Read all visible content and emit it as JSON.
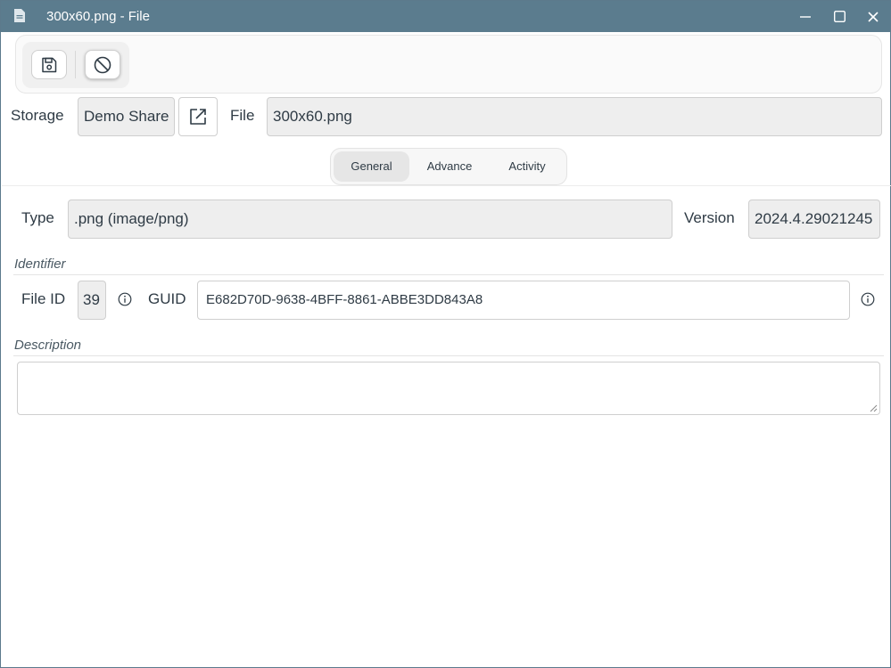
{
  "window": {
    "title": "300x60.png - File",
    "icons": {
      "app": "document-icon",
      "minimize": "minimize-icon",
      "maximize": "maximize-icon",
      "close": "close-icon"
    }
  },
  "toolbar": {
    "buttons": [
      {
        "name": "save",
        "icon": "save-icon"
      },
      {
        "name": "cancel",
        "icon": "cancel-icon"
      }
    ]
  },
  "header": {
    "storage_label": "Storage",
    "storage_value": "Demo Share",
    "open_icon": "external-link-icon",
    "file_label": "File",
    "file_value": "300x60.png"
  },
  "tabs": [
    {
      "label": "General",
      "active": true
    },
    {
      "label": "Advance",
      "active": false
    },
    {
      "label": "Activity",
      "active": false
    }
  ],
  "general": {
    "type_label": "Type",
    "type_value": ".png (image/png)",
    "version_label": "Version",
    "version_value": "2024.4.29021245",
    "identifier_section": "Identifier",
    "file_id_label": "File ID",
    "file_id_value": "39",
    "guid_label": "GUID",
    "guid_value": "E682D70D-9638-4BFF-8861-ABBE3DD843A8",
    "description_section": "Description",
    "description_value": ""
  },
  "colors": {
    "titlebar": "#5b7c8e",
    "readonly_field": "#eeeeee",
    "border": "#cfcfcf"
  }
}
